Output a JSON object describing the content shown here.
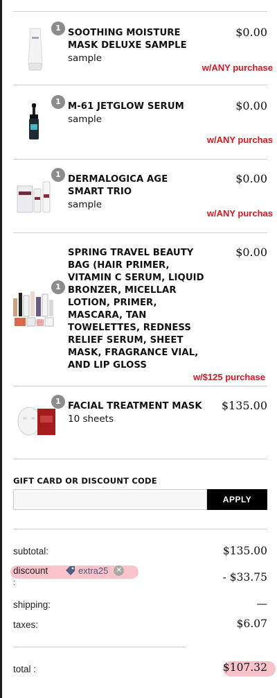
{
  "items": [
    {
      "badge": "1",
      "name_lines": [
        "SOOTHING MOISTURE",
        "MASK DELUXE SAMPLE"
      ],
      "subtitle": "sample",
      "price": "$0.00",
      "promo": "w/ANY purchase"
    },
    {
      "badge": "1",
      "name_lines": [
        "M-61 JETGLOW SERUM"
      ],
      "subtitle": "sample",
      "price": "$0.00",
      "promo": "w/ANY purchas"
    },
    {
      "badge": "1",
      "name_lines": [
        "DERMALOGICA AGE",
        "SMART TRIO"
      ],
      "subtitle": "sample",
      "price": "$0.00",
      "promo": "w/ANY purchas"
    },
    {
      "badge": "1",
      "name_lines": [
        "SPRING TRAVEL BEAUTY",
        "BAG (HAIR PRIMER,",
        "VITAMIN C SERUM, LIQUID",
        "BRONZER, MICELLAR",
        "LOTION, PRIMER,",
        "MASCARA, TAN",
        "TOWELETTES, REDNESS",
        "RELIEF SERUM, SHEET",
        "MASK, FRAGRANCE VIAL,",
        "AND LIP GLOSS"
      ],
      "subtitle": "",
      "price": "$0.00",
      "promo": "w/$125 purchase"
    },
    {
      "badge": "1",
      "name_lines": [
        "FACIAL TREATMENT MASK"
      ],
      "subtitle": "10 sheets",
      "price": "$135.00",
      "promo": ""
    }
  ],
  "gift_card": {
    "label": "GIFT CARD OR DISCOUNT CODE",
    "input_value": "",
    "input_placeholder": "",
    "apply_label": "APPLY"
  },
  "summary": {
    "subtotal_label": "subtotal:",
    "subtotal_value": "$135.00",
    "discount_label": "discount",
    "discount_colon": ":",
    "discount_code": "extra25",
    "discount_value": "- $33.75",
    "shipping_label": "shipping:",
    "shipping_value": "—",
    "taxes_label": "taxes:",
    "taxes_value": "$6.07",
    "total_label": "total :",
    "total_value": "$107.32"
  },
  "colors": {
    "promo_red": "#e0141e",
    "badge_grey": "#8c8c8c",
    "apply_bg": "#000000",
    "highlight_pink": "#f57887"
  },
  "icons": [
    "tag-icon",
    "remove-circle-icon"
  ]
}
